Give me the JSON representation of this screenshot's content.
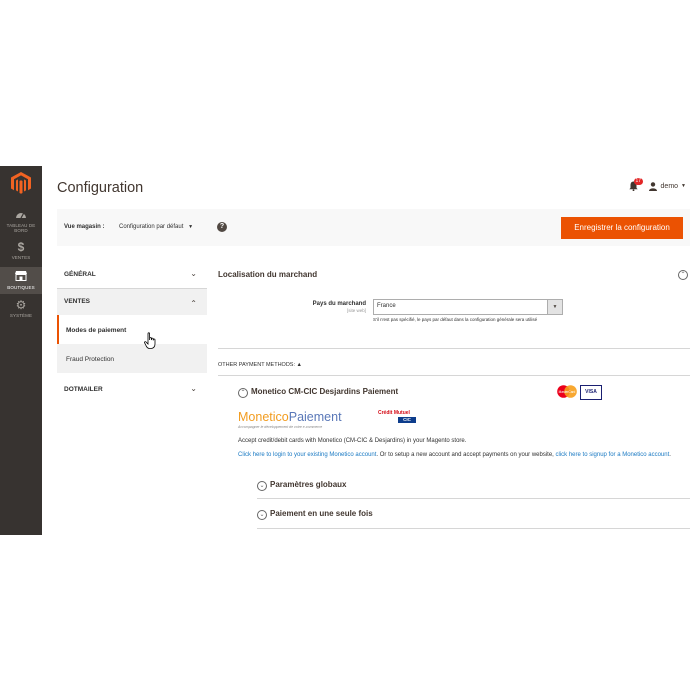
{
  "sidebar": {
    "logo": "magento-logo-icon",
    "items": [
      {
        "icon": "dashboard-icon",
        "label": "TABLEAU DE BORD"
      },
      {
        "icon": "dollar-icon",
        "label": "VENTES"
      },
      {
        "icon": "store-icon",
        "label": "BOUTIQUES"
      },
      {
        "icon": "gear-icon",
        "label": "SYSTÈME"
      }
    ]
  },
  "header": {
    "title": "Configuration",
    "notifications_count": "17",
    "user": "demo"
  },
  "store_bar": {
    "label": "Vue magasin :",
    "scope": "Configuration par défaut",
    "help": "?",
    "save_label": "Enregistrer la configuration"
  },
  "tabs": {
    "general": "GÉNÉRAL",
    "ventes": "VENTES",
    "ventes_items": [
      "Modes de paiement",
      "Fraud Protection"
    ],
    "dotmailer": "DOTMAILER"
  },
  "main": {
    "section_title": "Localisation du marchand",
    "field_label": "Pays du marchand",
    "field_scope": "[site web]",
    "field_value": "France",
    "field_note": "S'il n'est pas spécifié, le pays par défaut dans la configuration générale sera utilisé",
    "other_methods": "OTHER PAYMENT METHODS: ▲",
    "monetico_title": "Monetico CM-CIC Desjardins Paiement",
    "cards": {
      "mastercard": "MasterCard",
      "visa": "VISA"
    },
    "monetico_logo_a": "Monetico",
    "monetico_logo_b": "Paiement",
    "monetico_tagline": "Accompagner le développement de votre e-commerce",
    "cm_logo": "Crédit Mutuel",
    "cic_logo": "CIC",
    "description": "Accept credit/debit cards with Monetico (CM-CIC & Desjardins) in your Magento store.",
    "link_login": "Click here to login to your existing Monetico account",
    "link_middle": ". Or to setup a new account and accept payments on your website, ",
    "link_signup": "click here to signup for a Monetico account",
    "link_end": ".",
    "sub_sections": [
      "Paramètres globaux",
      "Paiement en une seule fois"
    ]
  },
  "colors": {
    "accent": "#eb5202",
    "sidebar": "#373330",
    "link": "#1979c3"
  }
}
